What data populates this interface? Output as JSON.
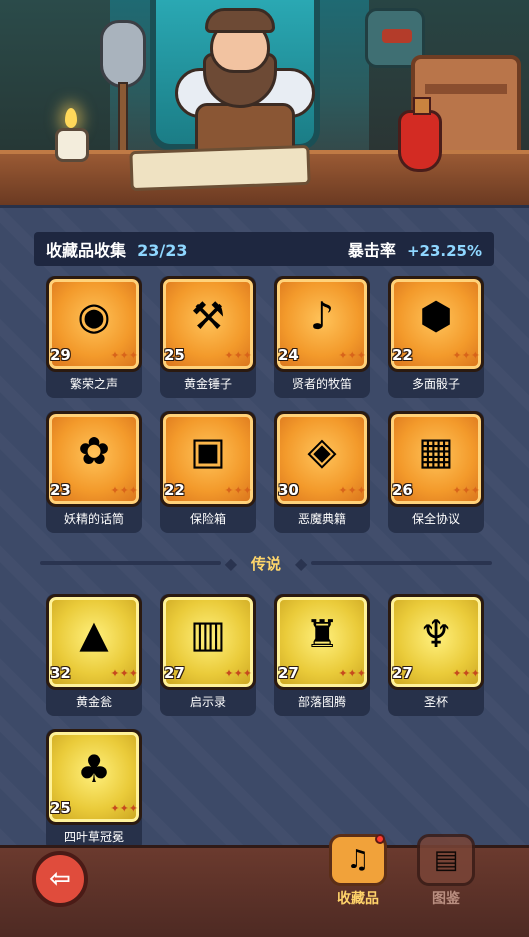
{
  "header": {
    "title": "收藏品收集",
    "count": "23/23",
    "crit_label": "暴击率",
    "crit_value": "+23.25%"
  },
  "epic_items": [
    {
      "name": "繁荣之声",
      "level": "29",
      "icon": "spirit-orb-icon"
    },
    {
      "name": "黄金锤子",
      "level": "25",
      "icon": "hammer-icon"
    },
    {
      "name": "贤者的牧笛",
      "level": "24",
      "icon": "flute-icon"
    },
    {
      "name": "多面骰子",
      "level": "22",
      "icon": "dice-icon"
    },
    {
      "name": "妖精的话筒",
      "level": "23",
      "icon": "fairy-microphone-icon"
    },
    {
      "name": "保险箱",
      "level": "22",
      "icon": "treasure-chest-icon"
    },
    {
      "name": "恶魔典籍",
      "level": "30",
      "icon": "demon-book-icon"
    },
    {
      "name": "保全协议",
      "level": "26",
      "icon": "scroll-icon"
    }
  ],
  "divider_label": "传说",
  "legend_items": [
    {
      "name": "黄金瓮",
      "level": "32",
      "icon": "golden-urn-icon"
    },
    {
      "name": "启示录",
      "level": "27",
      "icon": "open-book-icon"
    },
    {
      "name": "部落图腾",
      "level": "27",
      "icon": "totem-icon"
    },
    {
      "name": "圣杯",
      "level": "27",
      "icon": "grail-icon"
    },
    {
      "name": "四叶草冠冕",
      "level": "25",
      "icon": "clover-crown-icon"
    }
  ],
  "nav": {
    "back_icon": "back-arrow-icon",
    "collection_label": "收藏品",
    "codex_label": "图鉴"
  },
  "colors": {
    "epic": "#f39a2b",
    "legend": "#eacb3a",
    "accent_text": "#8fd7ff",
    "divider_text": "#ffd66b"
  }
}
